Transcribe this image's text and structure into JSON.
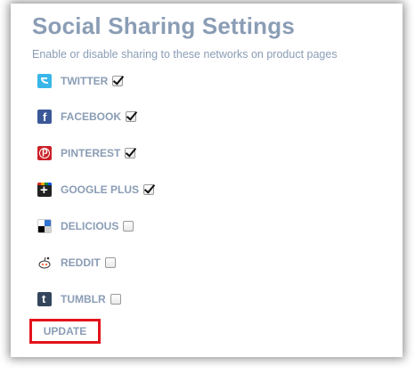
{
  "page": {
    "title": "Social Sharing Settings",
    "subtitle": "Enable or disable sharing to these networks on product pages"
  },
  "networks": [
    {
      "label": "TWITTER",
      "icon": "twitter-icon",
      "checked": true
    },
    {
      "label": "FACEBOOK",
      "icon": "facebook-icon",
      "checked": true
    },
    {
      "label": "PINTEREST",
      "icon": "pinterest-icon",
      "checked": true
    },
    {
      "label": "GOOGLE PLUS",
      "icon": "google-plus-icon",
      "checked": true
    },
    {
      "label": "DELICIOUS",
      "icon": "delicious-icon",
      "checked": false
    },
    {
      "label": "REDDIT",
      "icon": "reddit-icon",
      "checked": false
    },
    {
      "label": "TUMBLR",
      "icon": "tumblr-icon",
      "checked": false
    }
  ],
  "actions": {
    "update_label": "UPDATE"
  },
  "colors": {
    "text": "#8a9db5",
    "highlight_border": "#e3131b"
  }
}
